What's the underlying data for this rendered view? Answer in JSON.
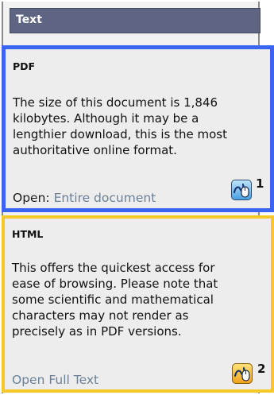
{
  "panel": {
    "header_title": "Text"
  },
  "options": [
    {
      "title": "PDF",
      "description": "The size of this document is 1,846 kilobytes. Although it may be a lengthier download, this is the most authoritative online format.",
      "open_label": "Open:",
      "link_text": "Entire document",
      "marker_number": "1",
      "icon": "mouse-click-icon",
      "highlight_color": "#3c64f2"
    },
    {
      "title": "HTML",
      "description": "This offers the quickest access for ease of browsing. Please note that some scientific and mathematical characters may not render as precisely as in PDF versions.",
      "link_text": "Open Full Text",
      "marker_number": "2",
      "icon": "mouse-click-icon",
      "highlight_color": "#f7c826"
    }
  ]
}
